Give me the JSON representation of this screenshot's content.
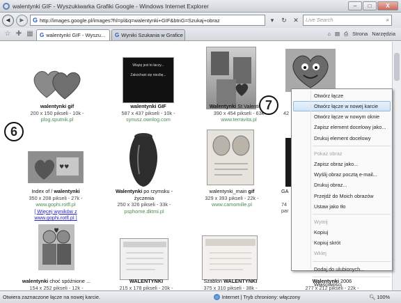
{
  "window": {
    "title": "walentynki GIF - Wyszukiwarka Grafiki Google - Windows Internet Explorer",
    "controls": {
      "minimize": "–",
      "maximize": "□",
      "close": "X"
    }
  },
  "address_bar": {
    "url": "http://images.google.pl/images?hl=pl&q=walentynki+GIF&btnG=Szukaj+obraz",
    "search_placeholder": "Live Search",
    "back_icon": "◄",
    "forward_icon": "►",
    "refresh_icon": "↻",
    "stop_icon": "✕",
    "dropdown_icon": "▾",
    "search_icon": "⌕"
  },
  "tabs": [
    {
      "label": "walentynki GIF - Wyszu...",
      "active": true
    },
    {
      "label": "Wyniki Szukania w Grafice ...",
      "active": false
    }
  ],
  "toolbar": {
    "home": "⌂",
    "feeds": "▤",
    "print": "⎙",
    "page": "Strona",
    "tools": "Narzędzia",
    "star": "☆"
  },
  "results": [
    {
      "name_bold": "walentynki gif",
      "name_rest": "",
      "meta": "200 x 150 pikseli - 10k -",
      "site": "plog.sputnik.pl"
    },
    {
      "name_bold": "walentynki GIF",
      "name_rest": "",
      "meta": "587 x 437 pikseli - 10k -",
      "site": "synusz.ownlog.com"
    },
    {
      "name_bold": "Walentynki",
      "name_rest": " St Valentine's",
      "meta": "390 x 454 pikseli - 63k",
      "site": "www.terravita.pl"
    },
    {
      "name_bold": "",
      "name_rest": "Index of / ",
      "name_bold2": "walentynki",
      "meta": "350 x 208 pikseli - 27k -",
      "site": "www.gophi.rotfl.pl",
      "more": "[ Więcej wyników z",
      "more2": "www.gophi.rotfl.pl ]"
    },
    {
      "name_bold": "Walentynki",
      "name_rest": " po rzymsku -",
      "name_line2": "życzenia",
      "meta": "250 x 326 pikseli - 33k -",
      "site": "psphome.dktmi.pl"
    },
    {
      "name_rest": "walentynki_main ",
      "name_bold2": "gif",
      "meta": "329 x 393 pikseli - 22k -",
      "site": "www.camomille.pl"
    },
    {
      "name_bold": "walentynki",
      "name_rest": " choć spóźnione ...",
      "meta": "154 x 252 pikseli - 12k -"
    },
    {
      "name_bold": "WALENTYNKI",
      "name_rest": "",
      "meta": "215 x 178 pikseli - 20k -"
    },
    {
      "name_rest": "Szablon ",
      "name_bold2": "WALENTYNKI",
      "meta": "375 x 310 pikseli - 38k -"
    },
    {
      "name_bold": "Walentynki",
      "name_rest": " 2006",
      "meta": "277 x 212 pikseli - 22k -"
    }
  ],
  "partial_labels": {
    "r1c4_meta": "42",
    "r2c4_name": "GA",
    "r2c4_meta1": "74",
    "r2c4_meta2": "par"
  },
  "thumb_texts": {
    "black_card_line1": "Wiążę jest to łaczy...",
    "black_card_line2": "Zakochani się niezbę..."
  },
  "callouts": {
    "six": "6",
    "seven": "7"
  },
  "context_menu": [
    {
      "label": "Otwórz łącze",
      "state": "normal"
    },
    {
      "label": "Otwórz łącze w nowej karcie",
      "state": "highlight"
    },
    {
      "label": "Otwórz łącze w nowym oknie",
      "state": "normal"
    },
    {
      "label": "Zapisz element docelowy jako...",
      "state": "normal"
    },
    {
      "label": "Drukuj element docelowy",
      "state": "normal"
    },
    {
      "sep": true
    },
    {
      "label": "Pokaż obraz",
      "state": "disabled"
    },
    {
      "label": "Zapisz obraz jako...",
      "state": "normal"
    },
    {
      "label": "Wyślij obraz pocztą e-mail...",
      "state": "normal"
    },
    {
      "label": "Drukuj obraz...",
      "state": "normal"
    },
    {
      "label": "Przejdź do Moich obrazów",
      "state": "normal"
    },
    {
      "label": "Ustaw jako tło",
      "state": "normal"
    },
    {
      "sep": true
    },
    {
      "label": "Wytnij",
      "state": "disabled"
    },
    {
      "label": "Kopiuj",
      "state": "normal"
    },
    {
      "label": "Kopiuj skrót",
      "state": "normal"
    },
    {
      "label": "Wklej",
      "state": "disabled"
    },
    {
      "sep": true
    },
    {
      "label": "Dodaj do ulubionych...",
      "state": "normal"
    },
    {
      "sep": true
    },
    {
      "label": "Właściwości",
      "state": "normal"
    }
  ],
  "statusbar": {
    "message": "Otwiera zaznaczone łącze na nowej karcie.",
    "zone": "Internet | Tryb chroniony: włączony",
    "zoom": "100%"
  }
}
